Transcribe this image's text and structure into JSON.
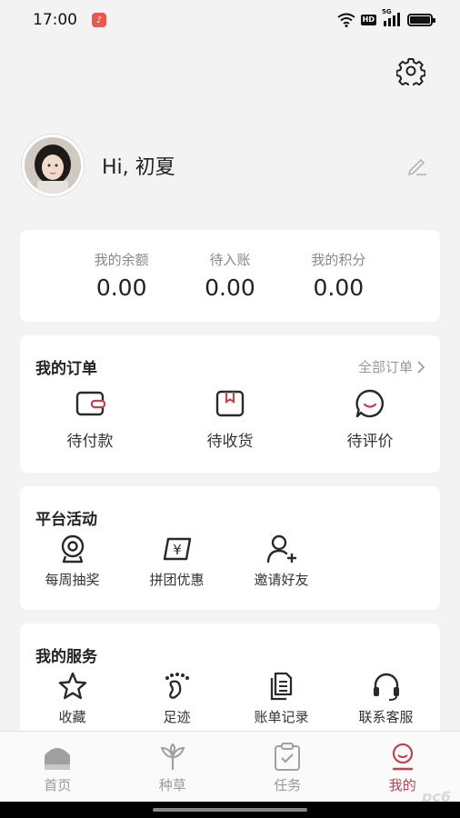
{
  "status_bar": {
    "time": "17:00",
    "hd": "HD",
    "network": "5G"
  },
  "profile": {
    "greeting": "Hi, 初夏"
  },
  "balance": [
    {
      "label": "我的余额",
      "value": "0.00"
    },
    {
      "label": "待入账",
      "value": "0.00"
    },
    {
      "label": "我的积分",
      "value": "0.00"
    }
  ],
  "orders": {
    "title": "我的订单",
    "all_label": "全部订单",
    "items": [
      {
        "label": "待付款",
        "icon": "wallet-icon"
      },
      {
        "label": "待收货",
        "icon": "package-icon"
      },
      {
        "label": "待评价",
        "icon": "comment-icon"
      }
    ]
  },
  "activities": {
    "title": "平台活动",
    "items": [
      {
        "label": "每周抽奖",
        "icon": "camera-icon"
      },
      {
        "label": "拼团优惠",
        "icon": "yuan-ticket-icon"
      },
      {
        "label": "邀请好友",
        "icon": "add-user-icon"
      }
    ]
  },
  "services": {
    "title": "我的服务",
    "items": [
      {
        "label": "收藏",
        "icon": "star-icon"
      },
      {
        "label": "足迹",
        "icon": "footprint-icon"
      },
      {
        "label": "账单记录",
        "icon": "bill-icon"
      },
      {
        "label": "联系客服",
        "icon": "headset-icon"
      }
    ]
  },
  "nav": [
    {
      "label": "首页",
      "icon": "home-icon"
    },
    {
      "label": "种草",
      "icon": "sprout-icon"
    },
    {
      "label": "任务",
      "icon": "task-icon"
    },
    {
      "label": "我的",
      "icon": "profile-icon",
      "active": true
    }
  ],
  "colors": {
    "accent": "#c2424f",
    "background": "#f3f3f3",
    "card": "#ffffff"
  },
  "watermark": "pc6"
}
